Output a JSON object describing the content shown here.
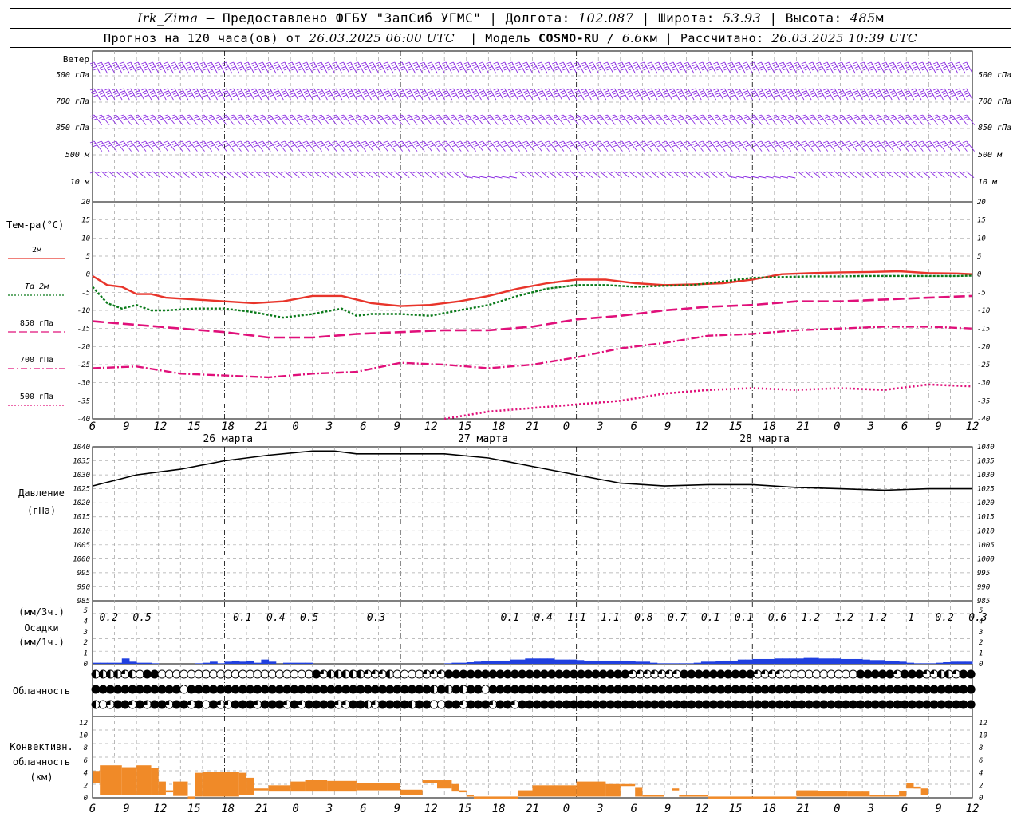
{
  "header": {
    "station": "Irk_Zima",
    "sep": " – ",
    "provided_by": "Предоставлено ФГБУ \"ЗапСиб УГМС\"",
    "lon_label": "Долгота:",
    "lon_value": "102.087",
    "lat_label": "Широта:",
    "lat_value": "53.93",
    "alt_label": "Высота:",
    "alt_value": "485",
    "alt_unit": "м",
    "forecast_prefix": "Прогноз на 120 часа(ов) от",
    "forecast_start": "26.03.2025 06:00 UTC",
    "model_label": "Модель",
    "model_name": "COSMO-RU",
    "model_res": "6.6",
    "model_res_unit": "км",
    "calc_label": "Рассчитано:",
    "calc_time": "26.03.2025 10:39 UTC"
  },
  "colors": {
    "wind": "#8a2be2",
    "t2m": "#e8342a",
    "td2m": "#0a7a1a",
    "t850": "#e0107a",
    "t700": "#e0107a",
    "t500": "#e0107a",
    "zero_line": "#3050ff",
    "pressure": "#000000",
    "precip_bars": "#2040e0",
    "convective": "#f08a28",
    "grid": "#a8a8a8"
  },
  "wind_panel": {
    "title": "Ветер",
    "levels": [
      "500 гПа",
      "700 гПа",
      "850 гПа",
      "500 м",
      "10  м"
    ]
  },
  "time_axis": {
    "hour_ticks": [
      "6",
      "9",
      "12",
      "15",
      "18",
      "21",
      "0",
      "3",
      "6",
      "9",
      "12",
      "15",
      "18",
      "21",
      "0",
      "3",
      "6",
      "9",
      "12",
      "15",
      "18",
      "21",
      "0",
      "3",
      "6",
      "9",
      "12"
    ],
    "date_labels": [
      "26 марта",
      "27 марта",
      "28 марта"
    ],
    "day_boundaries": [
      6,
      14,
      22
    ]
  },
  "temperature_panel": {
    "title": "Тем-ра(°C)",
    "legend": [
      {
        "level": "2м",
        "prefix": "",
        "style": "solid",
        "color_key": "t2m"
      },
      {
        "level": "2м",
        "prefix": "Td",
        "style": "dotted",
        "color_key": "td2m"
      },
      {
        "level": "850 гПа",
        "prefix": "",
        "style": "longdash",
        "color_key": "t850"
      },
      {
        "level": "700 гПа",
        "prefix": "",
        "style": "dashdot",
        "color_key": "t700"
      },
      {
        "level": "500 гПа",
        "prefix": "",
        "style": "dotted",
        "color_key": "t500"
      }
    ],
    "ticks": [
      "20",
      "15",
      "10",
      "5",
      "0",
      "-5",
      "-10",
      "-15",
      "-20",
      "-25",
      "-30",
      "-35",
      "-40"
    ]
  },
  "pressure_panel": {
    "title_lines": [
      "Давление",
      "(гПа)"
    ],
    "ticks": [
      "1040",
      "1035",
      "1030",
      "1025",
      "1020",
      "1015",
      "1010",
      "1005",
      "1000",
      "995",
      "990",
      "985"
    ]
  },
  "precip_panel": {
    "title_lines": [
      "(мм/3ч.)",
      "Осадки",
      "(мм/1ч.)"
    ],
    "ticks": [
      "5",
      "4",
      "3",
      "2",
      "1",
      "0"
    ],
    "totals": [
      "0.2",
      "0.5",
      "",
      "",
      "0.1",
      "0.4",
      "0.5",
      "",
      "0.3",
      "",
      "",
      "",
      "0.1",
      "0.4",
      "1.1",
      "1.1",
      "0.8",
      "0.7",
      "0.1",
      "0.1",
      "0.6",
      "1.2",
      "1.2",
      "1.2",
      "1",
      "0.2",
      "0.3"
    ]
  },
  "cloud_panel": {
    "title": "Облачность"
  },
  "convective_panel": {
    "title_lines": [
      "Конвективн.",
      "облачность",
      "(км)"
    ],
    "ticks": [
      "12",
      "10",
      "8",
      "6",
      "4",
      "2",
      "0"
    ]
  },
  "chart_data": [
    {
      "type": "line",
      "name": "temperature",
      "x_unit": "hours since 26.03.2025 06 UTC",
      "ylim": [
        -40,
        20
      ],
      "series": [
        {
          "name": "2м",
          "x": [
            0,
            2,
            4,
            6,
            8,
            10,
            14,
            18,
            22,
            26,
            30,
            34,
            38,
            42,
            46,
            50,
            54,
            58,
            62,
            66,
            70,
            74,
            78,
            82,
            86,
            90,
            94,
            98,
            102,
            106,
            110,
            114,
            118,
            120
          ],
          "values": [
            -0.5,
            -3,
            -3.5,
            -5.5,
            -5.5,
            -6.5,
            -7,
            -7.5,
            -8,
            -7.5,
            -6,
            -6,
            -8,
            -8.8,
            -8.5,
            -7.5,
            -6,
            -4,
            -2.5,
            -1.5,
            -1.5,
            -2.5,
            -3,
            -2.8,
            -2.5,
            -1.5,
            0,
            0.3,
            0.5,
            0.6,
            0.8,
            0.3,
            0.2,
            0
          ]
        },
        {
          "name": "Td 2м",
          "x": [
            0,
            2,
            4,
            6,
            8,
            10,
            14,
            18,
            22,
            26,
            30,
            34,
            36,
            38,
            42,
            46,
            50,
            54,
            58,
            62,
            66,
            70,
            74,
            78,
            82,
            86,
            90,
            94,
            98,
            102,
            106,
            110,
            114,
            118,
            120
          ],
          "values": [
            -3.5,
            -8,
            -9.5,
            -8.5,
            -10,
            -10,
            -9.5,
            -9.5,
            -10.5,
            -12,
            -11,
            -9.5,
            -11.5,
            -11,
            -11,
            -11.5,
            -10,
            -8.5,
            -6,
            -4,
            -3,
            -3,
            -3.5,
            -3.2,
            -3,
            -2,
            -1,
            -0.8,
            -0.6,
            -0.6,
            -0.5,
            -0.5,
            -0.5,
            -0.5,
            -0.4
          ]
        },
        {
          "name": "850 гПа",
          "x": [
            0,
            6,
            12,
            18,
            24,
            30,
            36,
            42,
            48,
            54,
            60,
            66,
            72,
            78,
            84,
            90,
            96,
            102,
            108,
            114,
            120
          ],
          "values": [
            -13,
            -14,
            -15,
            -16,
            -17.5,
            -17.5,
            -16.5,
            -16,
            -15.5,
            -15.5,
            -14.5,
            -12.5,
            -11.5,
            -10,
            -9,
            -8.5,
            -7.5,
            -7.5,
            -7,
            -6.5,
            -6
          ]
        },
        {
          "name": "700 гПа",
          "x": [
            0,
            6,
            12,
            18,
            24,
            30,
            36,
            42,
            48,
            54,
            60,
            66,
            72,
            78,
            84,
            90,
            96,
            102,
            108,
            114,
            120
          ],
          "values": [
            -26,
            -25.5,
            -27.5,
            -28,
            -28.5,
            -27.5,
            -27,
            -24.5,
            -25,
            -26,
            -25,
            -23,
            -20.5,
            -19,
            -17,
            -16.5,
            -15.5,
            -15,
            -14.5,
            -14.5,
            -15
          ]
        },
        {
          "name": "500 гПа",
          "x": [
            48,
            54,
            60,
            66,
            72,
            78,
            84,
            90,
            96,
            102,
            108,
            114,
            120
          ],
          "values": [
            -40,
            -38,
            -37,
            -36,
            -35,
            -33,
            -32,
            -31.5,
            -32,
            -31.5,
            -32,
            -30.5,
            -31
          ]
        }
      ]
    },
    {
      "type": "line",
      "name": "pressure",
      "x_unit": "hours since 26.03.2025 06 UTC",
      "ylim": [
        985,
        1040
      ],
      "series": [
        {
          "name": "pressure",
          "x": [
            0,
            3,
            6,
            9,
            12,
            18,
            24,
            30,
            33,
            36,
            42,
            48,
            54,
            60,
            66,
            72,
            78,
            84,
            90,
            96,
            102,
            108,
            114,
            120
          ],
          "values": [
            1026,
            1028,
            1030,
            1031,
            1032,
            1035,
            1037,
            1038.5,
            1038.5,
            1037.5,
            1037.5,
            1037.5,
            1036,
            1033,
            1030,
            1027,
            1026,
            1026.5,
            1026.5,
            1025.5,
            1025,
            1024.5,
            1025,
            1025
          ]
        }
      ]
    },
    {
      "type": "bar",
      "name": "precipitation_hourly",
      "x_unit": "hours since 26.03.2025 06 UTC",
      "ylim": [
        0,
        5
      ],
      "x": [
        0,
        1,
        2,
        3,
        4,
        5,
        6,
        7,
        8,
        14,
        15,
        16,
        17,
        18,
        19,
        20,
        21,
        22,
        23,
        24,
        26,
        27,
        28,
        29,
        48,
        49,
        50,
        51,
        52,
        53,
        54,
        55,
        56,
        57,
        58,
        59,
        60,
        61,
        62,
        63,
        64,
        65,
        66,
        67,
        68,
        69,
        70,
        71,
        72,
        73,
        74,
        75,
        76,
        77,
        78,
        79,
        80,
        81,
        82,
        83,
        84,
        85,
        86,
        87,
        88,
        89,
        90,
        91,
        92,
        93,
        94,
        95,
        96,
        97,
        98,
        99,
        100,
        101,
        102,
        103,
        104,
        105,
        106,
        107,
        108,
        109,
        110,
        111,
        112,
        113,
        114,
        115,
        116,
        117,
        118,
        119
      ],
      "values": [
        0.1,
        0.1,
        0.1,
        0.1,
        0.5,
        0.2,
        0.1,
        0.1,
        0.05,
        0.05,
        0.1,
        0.2,
        0.05,
        0.2,
        0.3,
        0.2,
        0.3,
        0.1,
        0.4,
        0.2,
        0.1,
        0.1,
        0.1,
        0.1,
        0.05,
        0.1,
        0.1,
        0.15,
        0.2,
        0.25,
        0.25,
        0.3,
        0.3,
        0.4,
        0.4,
        0.5,
        0.5,
        0.5,
        0.5,
        0.4,
        0.4,
        0.4,
        0.35,
        0.3,
        0.3,
        0.3,
        0.3,
        0.3,
        0.3,
        0.25,
        0.2,
        0.2,
        0.1,
        0.05,
        0.05,
        0.05,
        0.05,
        0.05,
        0.1,
        0.2,
        0.2,
        0.25,
        0.3,
        0.3,
        0.4,
        0.4,
        0.45,
        0.45,
        0.45,
        0.5,
        0.5,
        0.5,
        0.5,
        0.55,
        0.55,
        0.5,
        0.5,
        0.5,
        0.45,
        0.45,
        0.45,
        0.4,
        0.35,
        0.35,
        0.3,
        0.25,
        0.2,
        0.1,
        0.05,
        0.05,
        0.05,
        0.1,
        0.15,
        0.2,
        0.2,
        0.2
      ]
    },
    {
      "type": "bar",
      "name": "convective_cloud_km",
      "x_unit": "hours since 26.03.2025 06 UTC",
      "ylim": [
        0,
        13
      ],
      "ranges": [
        [
          0,
          1,
          2.4,
          4.3
        ],
        [
          1,
          4,
          0.5,
          5.2
        ],
        [
          4,
          6,
          0.5,
          4.9
        ],
        [
          6,
          8,
          0.5,
          5.2
        ],
        [
          8,
          9,
          0.5,
          4.8
        ],
        [
          9,
          10,
          0.5,
          2.6
        ],
        [
          10,
          11,
          1.2,
          1.2
        ],
        [
          11,
          13,
          0.3,
          2.6
        ],
        [
          13,
          14,
          0.2,
          0.2
        ],
        [
          14,
          15,
          0.2,
          4.0
        ],
        [
          15,
          20,
          0.2,
          4.1
        ],
        [
          20,
          21,
          0.5,
          4.0
        ],
        [
          21,
          22,
          0.5,
          3.2
        ],
        [
          22,
          24,
          1.5,
          1.5
        ],
        [
          24,
          27,
          1.0,
          2.0
        ],
        [
          27,
          29,
          1.0,
          2.6
        ],
        [
          29,
          32,
          1.0,
          2.9
        ],
        [
          32,
          36,
          1.0,
          2.7
        ],
        [
          36,
          42,
          1.2,
          2.3
        ],
        [
          42,
          45,
          0.5,
          1.3
        ],
        [
          45,
          47,
          2.3,
          2.8
        ],
        [
          47,
          49,
          1.5,
          2.8
        ],
        [
          49,
          50,
          1.0,
          2.2
        ],
        [
          50,
          51,
          1.0,
          1.2
        ],
        [
          51,
          52,
          0.5,
          0.5
        ],
        [
          52,
          58,
          0.2,
          0.2
        ],
        [
          58,
          60,
          0.2,
          1.2
        ],
        [
          60,
          66,
          0.2,
          2.0
        ],
        [
          66,
          70,
          0.2,
          2.6
        ],
        [
          70,
          72,
          0.2,
          2.2
        ],
        [
          72,
          74,
          2.2,
          2.2
        ],
        [
          74,
          75,
          0.2,
          1.6
        ],
        [
          75,
          78,
          0.2,
          0.5
        ],
        [
          79,
          80,
          1.5,
          1.5
        ],
        [
          80,
          84,
          0.5,
          0.5
        ],
        [
          84,
          96,
          0.2,
          0.2
        ],
        [
          96,
          99,
          0.2,
          1.2
        ],
        [
          99,
          103,
          0.2,
          1.1
        ],
        [
          103,
          106,
          0.2,
          1.0
        ],
        [
          106,
          107,
          0.5,
          0.5
        ],
        [
          107,
          110,
          0.2,
          0.5
        ],
        [
          110,
          111,
          0.2,
          1.1
        ],
        [
          111,
          112,
          1.5,
          2.4
        ],
        [
          112,
          113,
          1.8,
          1.8
        ],
        [
          113,
          114,
          0.5,
          1.5
        ]
      ]
    }
  ]
}
